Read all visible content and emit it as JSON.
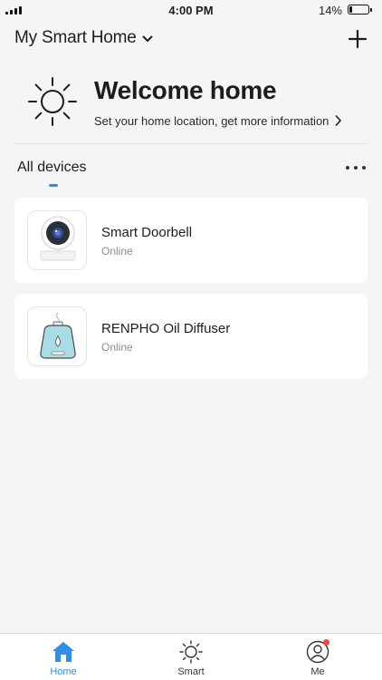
{
  "status_bar": {
    "time": "4:00 PM",
    "battery_percent": "14%",
    "battery_level": 0.14
  },
  "header": {
    "home_name": "My Smart Home",
    "add_icon": "plus-icon",
    "dropdown_icon": "chevron-down-icon"
  },
  "welcome": {
    "title": "Welcome home",
    "subtitle": "Set your home location, get more information",
    "icon": "sun-icon"
  },
  "devices_section": {
    "tab_label": "All devices",
    "more_icon": "more-icon"
  },
  "devices": [
    {
      "name": "Smart Doorbell",
      "status": "Online",
      "icon": "camera-icon"
    },
    {
      "name": "RENPHO Oil Diffuser",
      "status": "Online",
      "icon": "diffuser-icon"
    }
  ],
  "tab_bar": {
    "items": [
      {
        "label": "Home",
        "icon": "home-icon",
        "active": true
      },
      {
        "label": "Smart",
        "icon": "sun-icon",
        "active": false
      },
      {
        "label": "Me",
        "icon": "person-icon",
        "active": false,
        "badge": true
      }
    ]
  },
  "colors": {
    "accent": "#2f8ee8",
    "background": "#f5f5f6",
    "card": "#ffffff",
    "badge": "#f0453a",
    "muted_text": "#8e8e93"
  }
}
